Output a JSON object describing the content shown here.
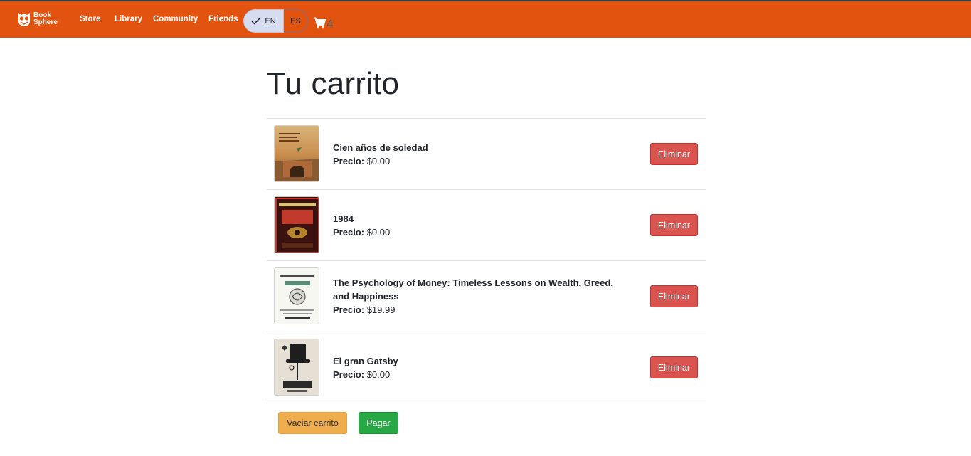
{
  "navbar": {
    "logo_line1": "Book",
    "logo_line2": "Sphere",
    "links": [
      "Store",
      "Library",
      "Community",
      "Friends"
    ],
    "languages": [
      "EN",
      "ES"
    ],
    "selected_language": "EN",
    "cart_count": "4",
    "bar_color": "#e2530f"
  },
  "page": {
    "title": "Tu carrito"
  },
  "cart": {
    "price_label": "Precio:",
    "remove_label": "Eliminar",
    "items": [
      {
        "title": "Cien años de soledad",
        "price": "$0.00",
        "cover_icon": "book-cover-cien-anos"
      },
      {
        "title": "1984",
        "price": "$0.00",
        "cover_icon": "book-cover-1984"
      },
      {
        "title": "The Psychology of Money: Timeless Lessons on Wealth, Greed, and Happiness",
        "price": "$19.99",
        "cover_icon": "book-cover-psychology-of-money"
      },
      {
        "title": "El gran Gatsby",
        "price": "$0.00",
        "cover_icon": "book-cover-gran-gatsby"
      }
    ],
    "clear_label": "Vaciar carrito",
    "pay_label": "Pagar"
  }
}
